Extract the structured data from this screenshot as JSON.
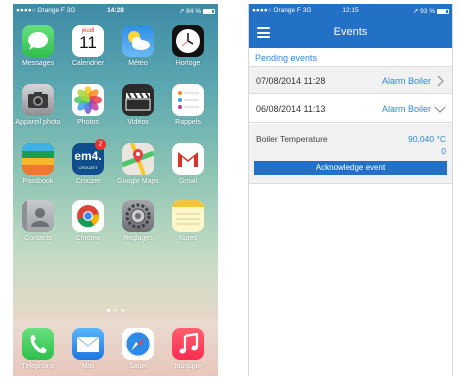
{
  "home_screen": {
    "status_bar": {
      "carrier": "●●●●○ Orange F  3G",
      "time": "14:28",
      "battery": "↗ 84 %"
    },
    "calendar": {
      "day_name": "jeudi",
      "day_number": "11"
    },
    "apps": [
      {
        "label": "Messages",
        "icon": "messages-icon",
        "color": "#4cd964"
      },
      {
        "label": "Calendrier",
        "icon": "calendar-icon",
        "color": "#ffffff"
      },
      {
        "label": "Météo",
        "icon": "weather-icon",
        "color": "#3d9ae8"
      },
      {
        "label": "Horloge",
        "icon": "clock-icon",
        "color": "#111111"
      },
      {
        "label": "Appareil photo",
        "icon": "camera-icon",
        "color": "#8e8e93"
      },
      {
        "label": "Photos",
        "icon": "photos-icon",
        "color": "#ffffff"
      },
      {
        "label": "Vidéos",
        "icon": "videos-icon",
        "color": "#2b2b2b"
      },
      {
        "label": "Rappels",
        "icon": "reminders-icon",
        "color": "#ffffff"
      },
      {
        "label": "Passbook",
        "icon": "passbook-icon",
        "color": "#1d9b4f"
      },
      {
        "label": "Crouzet",
        "icon": "crouzet-em4-icon",
        "color": "#0f4d8c",
        "badge": "2",
        "icon_text": "em4.",
        "icon_subtext": "CROUZET"
      },
      {
        "label": "Google Maps",
        "icon": "google-maps-icon",
        "color": "#e8e6df"
      },
      {
        "label": "Gmail",
        "icon": "gmail-icon",
        "color": "#ffffff"
      },
      {
        "label": "Contacts",
        "icon": "contacts-icon",
        "color": "#b9bcbf"
      },
      {
        "label": "Chrome",
        "icon": "chrome-icon",
        "color": "#ffffff"
      },
      {
        "label": "Réglages",
        "icon": "settings-icon",
        "color": "#8e8e93"
      },
      {
        "label": "Notes",
        "icon": "notes-icon",
        "color": "#fdf6c9"
      }
    ],
    "dock": [
      {
        "label": "Téléphone",
        "icon": "phone-icon",
        "color": "#4cd964"
      },
      {
        "label": "Mail",
        "icon": "mail-icon",
        "color": "#1f8ef1"
      },
      {
        "label": "Safari",
        "icon": "safari-icon",
        "color": "#ffffff"
      },
      {
        "label": "Musique",
        "icon": "music-icon",
        "color": "#fc3d55"
      }
    ]
  },
  "events_app": {
    "status_bar": {
      "carrier": "●●●●○ Orange F  3G",
      "time": "12:15",
      "battery": "↗ 93 %"
    },
    "header": {
      "title": "Events",
      "menu_icon": "hamburger-menu-icon"
    },
    "section_title": "Pending events",
    "events": [
      {
        "datetime": "07/08/2014 11:28",
        "name": "Alarm Boiler",
        "expanded": false
      },
      {
        "datetime": "06/08/2014 11:13",
        "name": "Alarm Boiler",
        "expanded": true
      }
    ],
    "detail": {
      "label": "Boiler Temperature",
      "value": "90,040 °C",
      "value2": "0"
    },
    "acknowledge_label": "Acknowledge event",
    "colors": {
      "primary": "#2371c6",
      "accent": "#2e86de"
    }
  }
}
